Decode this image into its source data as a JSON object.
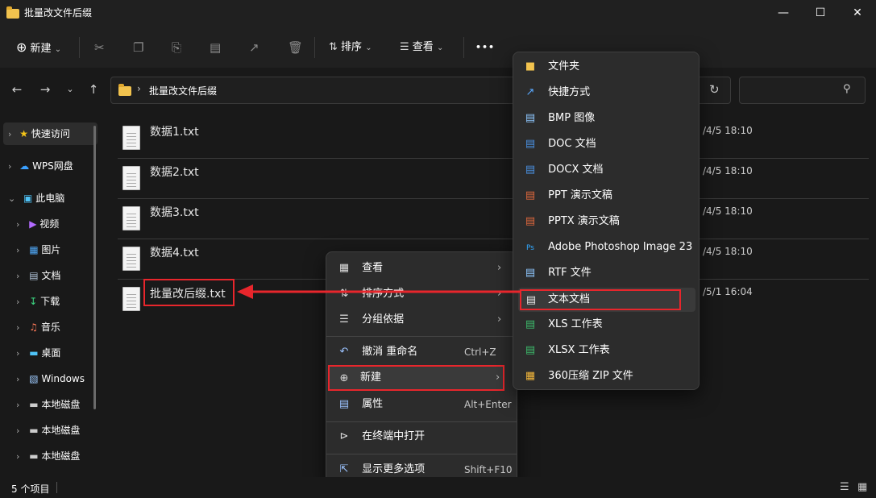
{
  "window": {
    "title": "批量改文件后缀"
  },
  "toolbar": {
    "new_label": "新建",
    "sort_label": "排序",
    "view_label": "查看",
    "more_label": "•••"
  },
  "address": {
    "path": "批量改文件后缀"
  },
  "sidebar": {
    "items": [
      {
        "label": "快速访问"
      },
      {
        "label": "WPS网盘"
      },
      {
        "label": "此电脑"
      },
      {
        "label": "视频"
      },
      {
        "label": "图片"
      },
      {
        "label": "文档"
      },
      {
        "label": "下载"
      },
      {
        "label": "音乐"
      },
      {
        "label": "桌面"
      },
      {
        "label": "Windows"
      },
      {
        "label": "本地磁盘"
      },
      {
        "label": "本地磁盘"
      },
      {
        "label": "本地磁盘"
      }
    ]
  },
  "files": [
    {
      "name": "数据1.txt",
      "date": "/4/5 18:10"
    },
    {
      "name": "数据2.txt",
      "date": "/4/5 18:10"
    },
    {
      "name": "数据3.txt",
      "date": "/4/5 18:10"
    },
    {
      "name": "数据4.txt",
      "date": "/4/5 18:10"
    },
    {
      "name": "批量改后缀.txt",
      "date": "/5/1 16:04"
    }
  ],
  "context_menu": {
    "view": "查看",
    "sort": "排序方式",
    "group": "分组依据",
    "undo": "撤消 重命名",
    "undo_shortcut": "Ctrl+Z",
    "new": "新建",
    "properties": "属性",
    "properties_shortcut": "Alt+Enter",
    "terminal": "在终端中打开",
    "more": "显示更多选项",
    "more_shortcut": "Shift+F10"
  },
  "new_submenu": [
    {
      "label": "文件夹",
      "icon": "folder-icon"
    },
    {
      "label": "快捷方式",
      "icon": "shortcut-icon"
    },
    {
      "label": "BMP 图像",
      "icon": "bmp-icon"
    },
    {
      "label": "DOC 文档",
      "icon": "doc-icon"
    },
    {
      "label": "DOCX 文档",
      "icon": "docx-icon"
    },
    {
      "label": "PPT 演示文稿",
      "icon": "ppt-icon"
    },
    {
      "label": "PPTX 演示文稿",
      "icon": "pptx-icon"
    },
    {
      "label": "Adobe Photoshop Image 23",
      "icon": "photoshop-icon"
    },
    {
      "label": "RTF 文件",
      "icon": "rtf-icon"
    },
    {
      "label": "文本文档",
      "icon": "text-doc-icon"
    },
    {
      "label": "XLS 工作表",
      "icon": "xls-icon"
    },
    {
      "label": "XLSX 工作表",
      "icon": "xlsx-icon"
    },
    {
      "label": "360压缩 ZIP 文件",
      "icon": "zip-icon"
    }
  ],
  "status": {
    "count": "5 个项目"
  },
  "colors": {
    "highlight": "#e8262c",
    "menu_bg": "#2c2c2c",
    "bg": "#191919"
  }
}
